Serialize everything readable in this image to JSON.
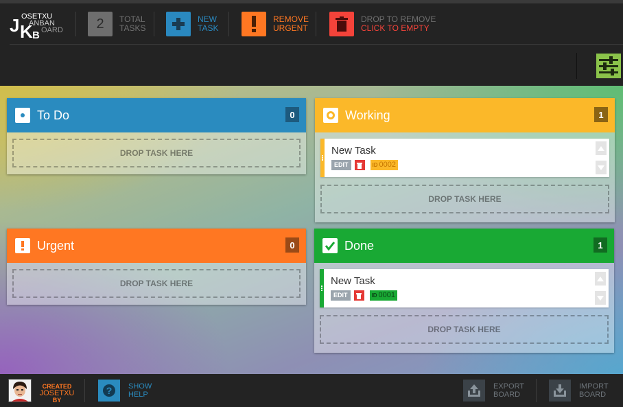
{
  "logo": {
    "j": "J",
    "k": "K",
    "b": "B",
    "line1": "OSETXU",
    "line2": "ANBAN",
    "line3": "OARD"
  },
  "header": {
    "total_tasks": {
      "count": "2",
      "line1": "TOTAL",
      "line2": "TASKS",
      "color": "#707070"
    },
    "new_task": {
      "line1": "NEW",
      "line2": "TASK",
      "color": "#2a89c0"
    },
    "remove_urgent": {
      "line1": "REMOVE",
      "line2": "URGENT",
      "color": "#ff7722"
    },
    "trash": {
      "line1": "DROP TO REMOVE",
      "line2": "CLICK TO EMPTY",
      "color": "#f4433a"
    },
    "settings_icon": "sliders-icon"
  },
  "columns": [
    {
      "id": "todo",
      "title": "To Do",
      "count": "0",
      "color": "#2a8bbf",
      "count_bg": "#1d5a7e",
      "icon": "dot-icon",
      "drop": "DROP TASK HERE",
      "tasks": []
    },
    {
      "id": "working",
      "title": "Working",
      "count": "1",
      "color": "#fbb829",
      "count_bg": "#8a6414",
      "icon": "circle-icon",
      "drop": "DROP TASK HERE",
      "tasks": [
        {
          "name": "New Task",
          "edit": "EDIT",
          "id_label": "ID",
          "id": "0002",
          "id_bg": "#fbb829",
          "id_color": "#c77700"
        }
      ]
    },
    {
      "id": "urgent",
      "title": "Urgent",
      "count": "0",
      "color": "#ff7722",
      "count_bg": "#9a4a17",
      "icon": "exclamation-icon",
      "drop": "DROP TASK HERE",
      "tasks": []
    },
    {
      "id": "done",
      "title": "Done",
      "count": "1",
      "color": "#19a934",
      "count_bg": "#116b21",
      "icon": "check-icon",
      "drop": "DROP TASK HERE",
      "tasks": [
        {
          "name": "New Task",
          "edit": "EDIT",
          "id_label": "ID",
          "id": "0001",
          "id_bg": "#19a934",
          "id_color": "#0b4716"
        }
      ]
    }
  ],
  "footer": {
    "credit": {
      "line1": "CREATED",
      "line2": "JOSETXU",
      "line3": "BY"
    },
    "help": {
      "line1": "SHOW",
      "line2": "HELP",
      "color": "#2a8bbf"
    },
    "export": {
      "line1": "EXPORT",
      "line2": "BOARD"
    },
    "import": {
      "line1": "IMPORT",
      "line2": "BOARD"
    }
  }
}
